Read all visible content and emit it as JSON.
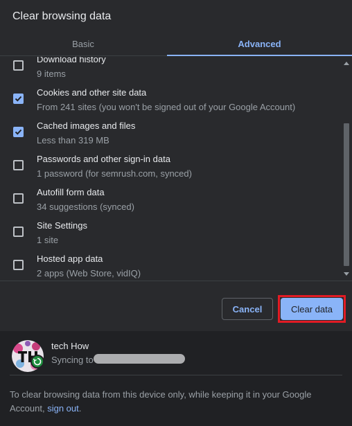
{
  "dialog": {
    "title": "Clear browsing data"
  },
  "tabs": [
    {
      "label": "Basic",
      "selected": false
    },
    {
      "label": "Advanced",
      "selected": true
    }
  ],
  "items": [
    {
      "label": "Download history",
      "sub": "9 items",
      "checked": false
    },
    {
      "label": "Cookies and other site data",
      "sub": "From 241 sites (you won't be signed out of your Google Account)",
      "checked": true
    },
    {
      "label": "Cached images and files",
      "sub": "Less than 319 MB",
      "checked": true
    },
    {
      "label": "Passwords and other sign-in data",
      "sub": "1 password (for semrush.com, synced)",
      "checked": false
    },
    {
      "label": "Autofill form data",
      "sub": "34 suggestions (synced)",
      "checked": false
    },
    {
      "label": "Site Settings",
      "sub": "1 site",
      "checked": false
    },
    {
      "label": "Hosted app data",
      "sub": "2 apps (Web Store, vidIQ)",
      "checked": false
    }
  ],
  "buttons": {
    "cancel": "Cancel",
    "clear": "Clear data"
  },
  "account": {
    "name": "tech How",
    "sync_prefix": "Syncing to"
  },
  "footer": {
    "note": "To clear browsing data from this device only, while keeping it in your Google Account,",
    "sign_out": "sign out",
    "note_end": "."
  },
  "colors": {
    "accent": "#8ab4f8",
    "highlight": "#e21b24",
    "background": "#292a2d"
  }
}
